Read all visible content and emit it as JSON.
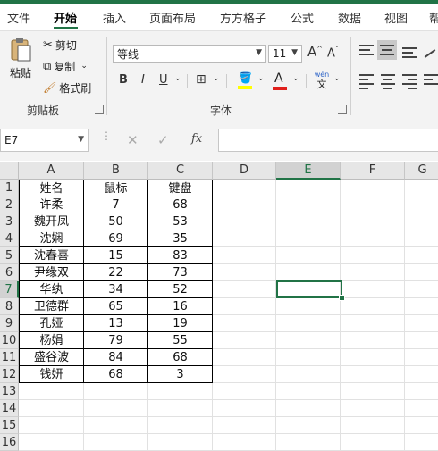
{
  "tabs": [
    "文件",
    "开始",
    "插入",
    "页面布局",
    "方方格子",
    "公式",
    "数据",
    "视图",
    "帮"
  ],
  "active_tab": "开始",
  "clipboard": {
    "paste_label": "粘贴",
    "cut_label": "剪切",
    "copy_label": "复制",
    "format_painter_label": "格式刷",
    "group_label": "剪贴板"
  },
  "font": {
    "font_name": "等线",
    "font_size": "11",
    "bold": "B",
    "italic": "I",
    "underline": "U",
    "grow_label": "A",
    "shrink_label": "A",
    "font_color_label": "A",
    "phonetic_top": "wén",
    "phonetic_bottom": "文",
    "group_label": "字体"
  },
  "formula_bar": {
    "name_box": "E7",
    "fx": "fx",
    "value": ""
  },
  "columns": [
    "A",
    "B",
    "C",
    "D",
    "E",
    "F",
    "G"
  ],
  "rows": [
    "1",
    "2",
    "3",
    "4",
    "5",
    "6",
    "7",
    "8",
    "9",
    "10",
    "11",
    "12",
    "13",
    "14",
    "15",
    "16"
  ],
  "table": {
    "header": [
      "姓名",
      "鼠标",
      "键盘"
    ],
    "rows": [
      [
        "许柔",
        "7",
        "68"
      ],
      [
        "魏开凤",
        "50",
        "53"
      ],
      [
        "沈娴",
        "69",
        "35"
      ],
      [
        "沈春喜",
        "15",
        "83"
      ],
      [
        "尹缘双",
        "22",
        "73"
      ],
      [
        "华纨",
        "34",
        "52"
      ],
      [
        "卫德群",
        "65",
        "16"
      ],
      [
        "孔娅",
        "13",
        "19"
      ],
      [
        "杨娟",
        "79",
        "55"
      ],
      [
        "盛谷波",
        "84",
        "68"
      ],
      [
        "钱妍",
        "68",
        "3"
      ]
    ]
  },
  "selected_cell": "E7",
  "colors": {
    "accent": "#217346"
  }
}
